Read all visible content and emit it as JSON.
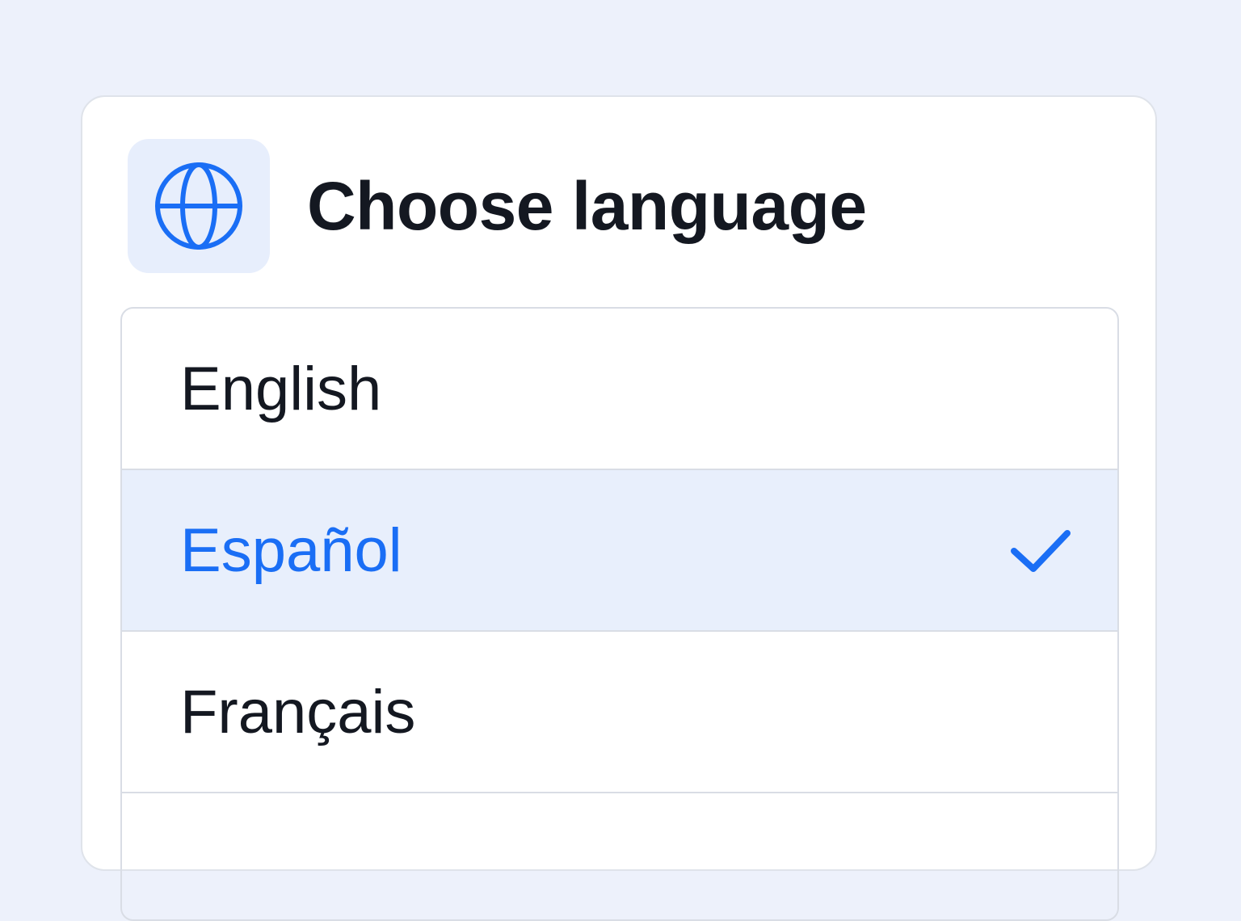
{
  "dialog": {
    "title": "Choose language",
    "icon": "globe-icon"
  },
  "languages": {
    "options": [
      {
        "label": "English",
        "selected": false
      },
      {
        "label": "Español",
        "selected": true
      },
      {
        "label": "Français",
        "selected": false
      }
    ],
    "check_icon": "checkmark-icon"
  },
  "colors": {
    "background": "#edf1fb",
    "card": "#ffffff",
    "accent": "#1a6ef5",
    "icon_tile": "#e7eefc",
    "selected_row": "#e8effc",
    "text": "#141821",
    "divider": "#d9dde5"
  }
}
